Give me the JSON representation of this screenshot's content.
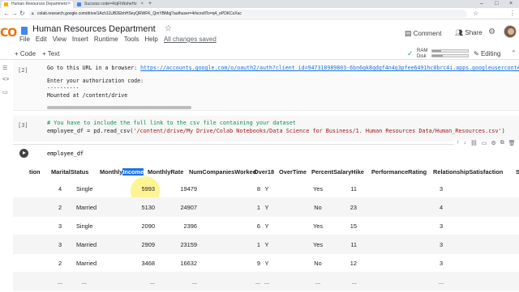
{
  "browser": {
    "tabs": [
      {
        "title": "Human Resources Department"
      },
      {
        "title": "Success code=4/qFhNsheHz"
      }
    ],
    "url": "colab.research.google.com/drive/1Ach11UB2EbhHSeyQRWFK_QmYBMqj?authuser=4#scrollTo=q4_ePDKCsXuc"
  },
  "notebook": {
    "logo": "CO",
    "title": "Human Resources Department",
    "menu": [
      "File",
      "Edit",
      "View",
      "Insert",
      "Runtime",
      "Tools",
      "Help"
    ],
    "saved_status": "All changes saved",
    "comment_label": "Comment",
    "share_label": "Share"
  },
  "toolbar": {
    "add_code": "+ Code",
    "add_text": "+ Text",
    "ram_label": "RAM",
    "disk_label": "Disk",
    "ram_level": 0.25,
    "disk_level": 0.3,
    "editing_label": "Editing"
  },
  "cells": {
    "auth": {
      "number": "[2]",
      "line1_prefix": "Go to this URL in a browser: ",
      "line1_link": "https://accounts.google.com/o/oauth2/auth?client_id=947318989803-6bn6qk8qdgf4n4g3pfee6491hc0brc4i.apps.googleusercontent.com",
      "line2": "Enter your authorization code:",
      "line3": "··········",
      "line4": "Mounted at /content/drive"
    },
    "read_csv": {
      "number": "[3]",
      "comment": "# You have to include the full link to the csv file containing your dataset",
      "code_prefix": "employee_df = pd.read_csv(",
      "code_string": "'/content/drive/My Drive/Colab Notebooks/Data Science for Business/1. Human Resources Data/Human_Resources.csv'",
      "code_suffix": ")"
    },
    "display": {
      "code": "employee_df"
    }
  },
  "dataframe": {
    "columns": [
      "tion",
      "MaritalStatus",
      "Monthly",
      "Income",
      "MonthlyRate",
      "NumCompaniesWorked",
      "Over18",
      "OverTime",
      "PercentSalaryHike",
      "PerformanceRating",
      "RelationshipSatisfaction",
      "S"
    ],
    "rows": [
      [
        "4",
        "Single",
        "5993",
        "19479",
        "8",
        "Y",
        "Yes",
        "11",
        "3",
        "1"
      ],
      [
        "2",
        "Married",
        "5130",
        "24907",
        "1",
        "Y",
        "No",
        "23",
        "4",
        "4"
      ],
      [
        "3",
        "Single",
        "2090",
        "2396",
        "6",
        "Y",
        "Yes",
        "15",
        "3",
        "2"
      ],
      [
        "3",
        "Married",
        "2909",
        "23159",
        "1",
        "Y",
        "Yes",
        "11",
        "3",
        "3"
      ],
      [
        "2",
        "Married",
        "3468",
        "16632",
        "9",
        "Y",
        "No",
        "12",
        "3",
        "4"
      ],
      [
        "...",
        "...",
        "...",
        "...",
        "...",
        "...",
        "...",
        "...",
        "...",
        "..."
      ]
    ]
  }
}
